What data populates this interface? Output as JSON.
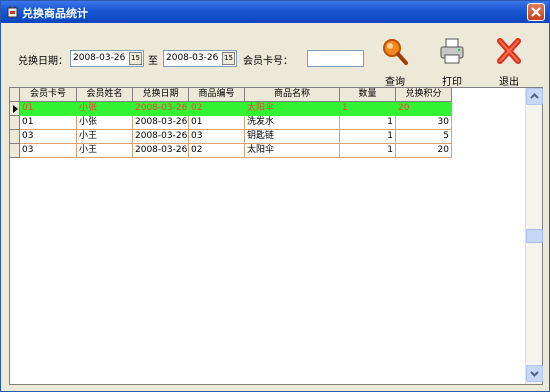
{
  "window": {
    "title": "兑换商品统计"
  },
  "filters": {
    "date_label": "兑换日期：",
    "date_from": "2008-03-26",
    "to_label": "至",
    "date_to": "2008-03-26",
    "card_label": "会员卡号：",
    "card_value": "",
    "calendar_glyph": "15"
  },
  "toolbar": {
    "query_label": "查询",
    "print_label": "打印",
    "exit_label": "退出"
  },
  "grid": {
    "columns": [
      "会员卡号",
      "会员姓名",
      "兑换日期",
      "商品编号",
      "商品名称",
      "数量",
      "兑换积分"
    ],
    "rows": [
      {
        "card": "01",
        "name": "小张",
        "date": "2008-03-26",
        "code": "02",
        "product": "太阳伞",
        "qty": "1",
        "points": "20"
      },
      {
        "card": "01",
        "name": "小张",
        "date": "2008-03-26",
        "code": "01",
        "product": "洗发水",
        "qty": "1",
        "points": "30"
      },
      {
        "card": "03",
        "name": "小王",
        "date": "2008-03-26",
        "code": "03",
        "product": "钥匙链",
        "qty": "1",
        "points": "5"
      },
      {
        "card": "03",
        "name": "小王",
        "date": "2008-03-26",
        "code": "02",
        "product": "太阳伞",
        "qty": "1",
        "points": "20"
      }
    ]
  },
  "colors": {
    "selected_row_bg": "#33f233",
    "selected_row_text": "#ff3b3b",
    "titlebar": "#0b44bd"
  },
  "icons": [
    "app-icon",
    "close-icon",
    "search-icon",
    "printer-icon",
    "exit-icon"
  ]
}
